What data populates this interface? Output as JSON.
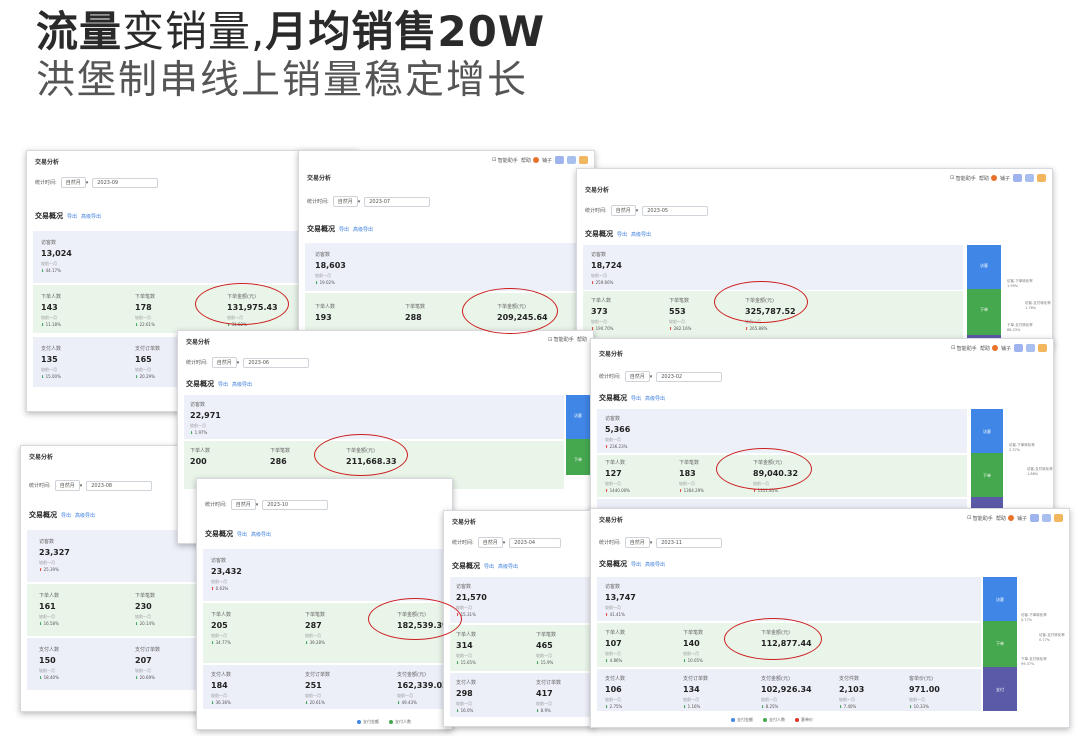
{
  "headline": {
    "line1_bold_a": "流量",
    "line1_thin": "变销量,",
    "line1_bold_b": "月均销售20W",
    "line2": "洪堡制串线上销量稳定增长"
  },
  "ui": {
    "title": "交易分析",
    "stat_period": "统计时间:",
    "period_value": "自然月",
    "overview": "交易概况",
    "export": "导出",
    "adv_export": "高级导出",
    "visitors": "访客数",
    "buyers": "下单人数",
    "orders": "下单笔数",
    "amount": "下单金额(元)",
    "pay_buyers": "支付人数",
    "pay_orders": "支付订单数",
    "pay_amount": "支付金额(元)",
    "pay_items": "支付件数",
    "per_customer": "客单价(元)",
    "prev_month": "较前一月",
    "assistant": "智能助手",
    "help": "帮助",
    "shop": "铺子",
    "funnel_visit": "访客",
    "funnel_order": "下单",
    "funnel_pay": "支付",
    "conv_visit_order": "访客-下单转化率",
    "conv_order_pay": "下单-支付转化率",
    "conv_visit_pay": "访客-支付转化率",
    "legend_pay_amount": "支付金额",
    "legend_pay_buyers": "支付人数",
    "legend_per_customer": "客单价"
  },
  "shots": {
    "sep": {
      "date": "2023-09",
      "visitors": "13,024",
      "visitors_chg": "44.17%",
      "buyers": "143",
      "buyers_chg": "11.18%",
      "orders": "178",
      "orders_chg": "22.61%",
      "amount": "131,975.43",
      "amount_chg": "31.82%",
      "pay_buyers": "135",
      "pay_buyers_chg": "15.00%",
      "pay_orders": "165",
      "pay_orders_chg": "20.29%"
    },
    "jul": {
      "date": "2023-07",
      "visitors": "18,603",
      "visitors_chg": "19.02%",
      "buyers": "193",
      "orders": "288",
      "amount": "209,245.64"
    },
    "may": {
      "date": "2023-05",
      "visitors": "18,724",
      "visitors_chg": "259.66%",
      "buyers": "373",
      "buyers_chg": "190.70%",
      "orders": "553",
      "orders_chg": "282.16%",
      "amount": "325,787.52",
      "amount_chg": "265.88%",
      "conv_a": "1.99%",
      "conv_b": "1.76%",
      "conv_c": "88.23%"
    },
    "jun": {
      "date": "2023-06",
      "visitors": "22,971",
      "visitors_chg": "1.97%",
      "buyers": "200",
      "orders": "286",
      "amount": "211,668.33"
    },
    "feb": {
      "date": "2023-02",
      "visitors": "5,366",
      "visitors_chg": "236.23%",
      "buyers": "127",
      "buyers_chg": "1440.00%",
      "orders": "183",
      "orders_chg": "1364.29%",
      "amount": "89,040.32",
      "amount_chg": "1311.85%",
      "conv_a": "2.37%",
      "conv_b": "1.86%"
    },
    "aug": {
      "date": "2023-08",
      "visitors": "23,327",
      "visitors_chg": "25.39%",
      "buyers": "161",
      "buyers_chg": "16.58%",
      "orders": "230",
      "orders_chg": "20.14%",
      "pay_buyers": "150",
      "pay_buyers_chg": "18.40%",
      "pay_orders": "207",
      "pay_orders_chg": "20.69%"
    },
    "oct": {
      "date": "2023-10",
      "visitors": "23,432",
      "visitors_chg": "0.63%",
      "buyers": "205",
      "buyers_chg": "34.77%",
      "orders": "287",
      "orders_chg": "39.28%",
      "amount": "182,539.39",
      "pay_buyers": "184",
      "pay_buyers_chg": "36.36%",
      "pay_orders": "251",
      "pay_orders_chg": "20.61%",
      "pay_amount": "162,339.03",
      "pay_amount_chg": "49.43%"
    },
    "apr": {
      "date": "2023-04",
      "visitors": "21,570",
      "visitors_chg": "15.31%",
      "buyers": "314",
      "buyers_chg": "15.65%",
      "orders": "465",
      "orders_chg": "15.9%",
      "pay_buyers": "298",
      "pay_buyers_chg": "16.0%",
      "pay_orders": "417",
      "pay_orders_chg": "8.9%"
    },
    "nov": {
      "date": "2023-11",
      "visitors": "13,747",
      "visitors_chg": "41.41%",
      "buyers": "107",
      "buyers_chg": "4.86%",
      "orders": "140",
      "orders_chg": "10.05%",
      "amount": "112,877.44",
      "pay_buyers": "106",
      "pay_buyers_chg": "2.75%",
      "pay_orders": "134",
      "pay_orders_chg": "1.16%",
      "pay_amount": "102,926.34",
      "pay_amount_chg": "8.25%",
      "pay_items": "2,103",
      "pay_items_chg": "7.40%",
      "per_customer": "971.00",
      "per_customer_chg": "10.33%",
      "conv_a": "0.77%",
      "conv_b": "99.37%",
      "conv_c": "0.77%"
    }
  },
  "colors": {
    "annotation": "#cc1f1f",
    "funnel_visit": "#3f86e6",
    "funnel_order": "#45a84f",
    "funnel_pay": "#5b5aa8",
    "up": "#d9342b",
    "down": "#2e9b4e"
  }
}
